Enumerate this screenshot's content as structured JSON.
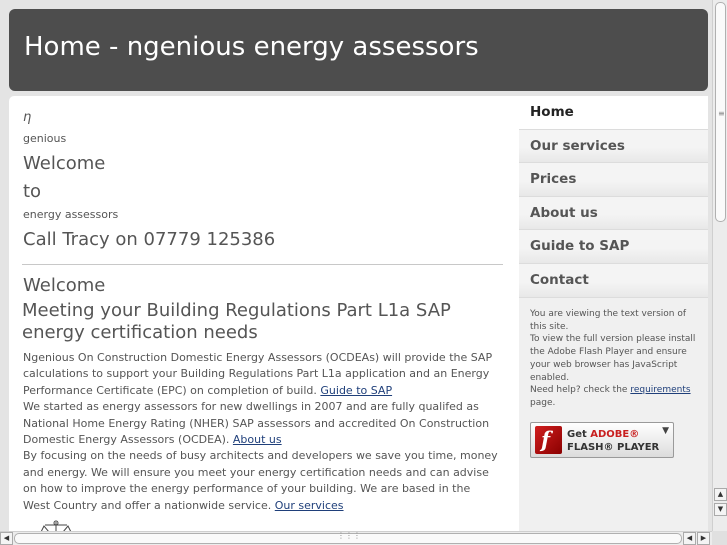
{
  "header": {
    "title": "Home - ngenious energy assessors"
  },
  "main": {
    "logo_symbol": "η",
    "logo_word": "genious",
    "welcome_1": "Welcome",
    "welcome_2": "to",
    "tagline": "energy assessors",
    "phone_line": "Call Tracy on 07779 125386",
    "section_title": "Welcome",
    "section_heading": "Meeting your Building Regulations Part L1a SAP energy certification needs",
    "para1": "Ngenious On Construction Domestic Energy Assessors (OCDEAs) will provide the SAP calculations to support your Building Regulations Part L1a application and an Energy Performance Certificate (EPC) on completion of build.",
    "para1_link": "Guide to SAP",
    "para2": "We started as energy assessors for new dwellings in 2007 and are fully qualifed as National Home Energy Rating (NHER) SAP assessors and accredited On Construction Domestic Energy Assessors (OCDEA).",
    "para2_link": "About us",
    "para3": "By focusing on the needs of busy architects and developers we save you time, money and energy. We will ensure you meet your energy certification needs and can advise on how to improve the energy performance of your building. We are based in the West Country and offer a nationwide service.",
    "para3_link": "Our services",
    "bottom_icon": "scales-icon"
  },
  "sidebar": {
    "nav": [
      {
        "label": "Home",
        "active": true
      },
      {
        "label": "Our services",
        "active": false
      },
      {
        "label": "Prices",
        "active": false
      },
      {
        "label": "About us",
        "active": false
      },
      {
        "label": "Guide to SAP",
        "active": false
      },
      {
        "label": "Contact",
        "active": false
      }
    ],
    "flash_note_1": "You are viewing the text version of this site.",
    "flash_note_2": "To view the full version please install the Adobe Flash Player and ensure your web browser has JavaScript enabled.",
    "flash_note_3a": "Need help? check the",
    "flash_note_link": "requirements",
    "flash_note_3b": "page.",
    "flash_button": {
      "get": "Get",
      "adobe": "ADOBE®",
      "product": "FLASH® PLAYER",
      "icon": "f"
    }
  },
  "colors": {
    "header_bg": "#4d4d4d",
    "page_bg": "#e4e4e4",
    "text": "#555555",
    "link": "#1f3f7a",
    "flash_red": "#c81e1e"
  }
}
